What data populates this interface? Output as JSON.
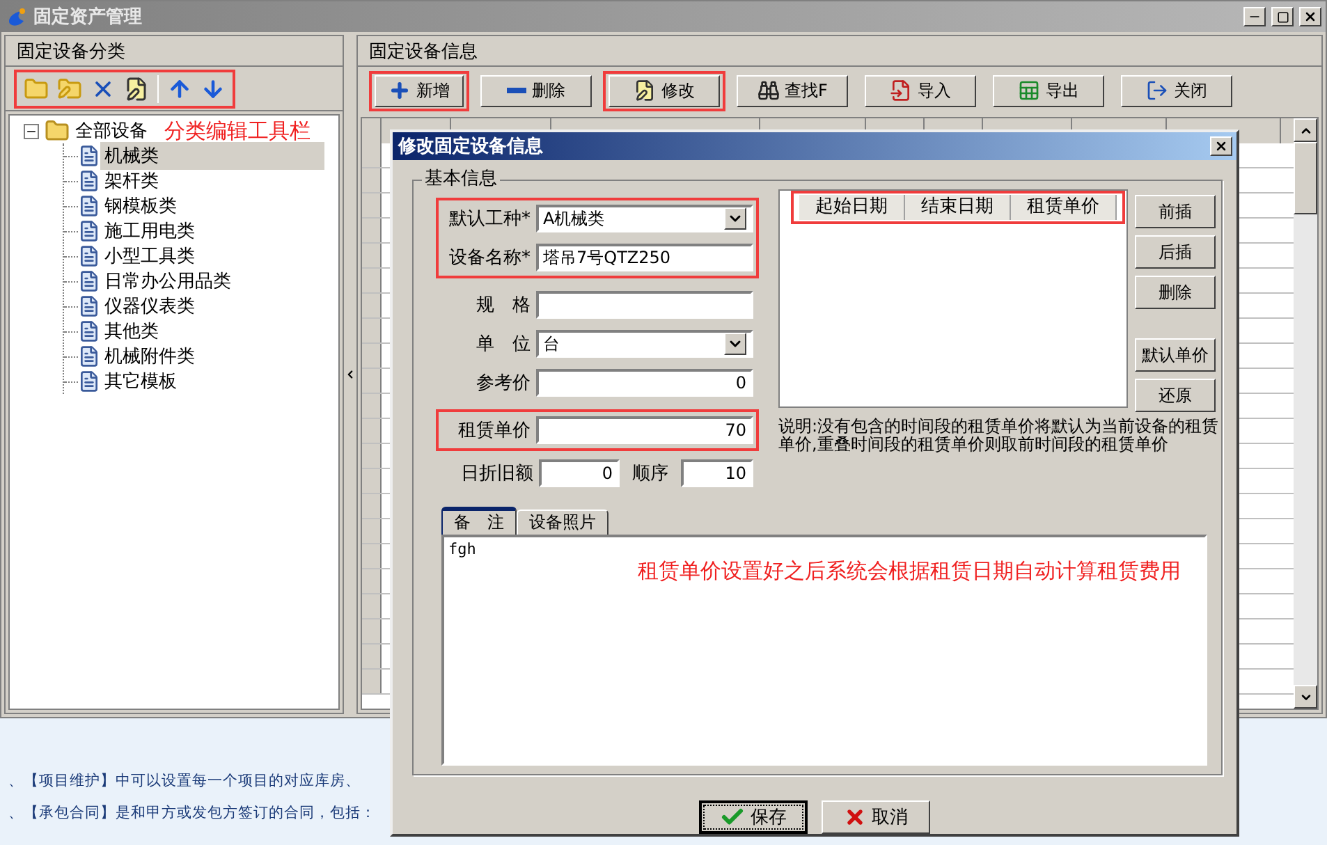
{
  "window": {
    "title": "固定资产管理"
  },
  "left_panel": {
    "title": "固定设备分类",
    "toolbar": {
      "highlighted": true,
      "tools": [
        {
          "kind": "new-folder"
        },
        {
          "kind": "edit-folder"
        },
        {
          "kind": "delete"
        },
        {
          "kind": "edit"
        },
        {
          "kind": "up"
        },
        {
          "kind": "down"
        }
      ]
    },
    "tree": {
      "label": "全部设备",
      "expanded": true,
      "annotation": "分类编辑工具栏",
      "children": [
        {
          "label": "机械类",
          "selected": true
        },
        {
          "label": "架杆类",
          "selected": false
        },
        {
          "label": "钢模板类",
          "selected": false
        },
        {
          "label": "施工用电类",
          "selected": false
        },
        {
          "label": "小型工具类",
          "selected": false
        },
        {
          "label": "日常办公用品类",
          "selected": false
        },
        {
          "label": "仪器仪表类",
          "selected": false
        },
        {
          "label": "其他类",
          "selected": false
        },
        {
          "label": "机械附件类",
          "selected": false
        },
        {
          "label": "其它模板",
          "selected": false
        }
      ]
    }
  },
  "right_panel": {
    "title": "固定设备信息",
    "toolbar": [
      {
        "label": "新增",
        "highlighted": true
      },
      {
        "label": "删除",
        "highlighted": false
      },
      {
        "label": "修改",
        "highlighted": true
      },
      {
        "label": "查找F",
        "highlighted": false
      },
      {
        "label": "导入",
        "highlighted": false
      },
      {
        "label": "导出",
        "highlighted": false
      },
      {
        "label": "关闭",
        "highlighted": false
      }
    ]
  },
  "dialog": {
    "title": "修改固定设备信息",
    "group_title": "基本信息",
    "field_groups": [
      {
        "highlighted": true,
        "fields": [
          {
            "label": "默认工种*",
            "kind": "select",
            "value": "A机械类"
          },
          {
            "label": "设备名称*",
            "kind": "text",
            "value": "塔吊7号QTZ250"
          }
        ]
      },
      {
        "highlighted": false,
        "fields": [
          {
            "label": "规　格",
            "kind": "text"
          },
          {
            "label": "单　位",
            "kind": "select",
            "value": "台"
          },
          {
            "label": "参考价",
            "kind": "number",
            "value": "0"
          }
        ]
      },
      {
        "highlighted": true,
        "fields": [
          {
            "label": "租赁单价",
            "kind": "number",
            "value": "70"
          }
        ]
      }
    ],
    "last_row": [
      {
        "label": "日折旧额",
        "value": "0"
      },
      {
        "label": "顺序",
        "value": "10"
      }
    ],
    "rental_table": {
      "highlighted": true,
      "columns": [
        "起始日期",
        "结束日期",
        "租赁单价"
      ]
    },
    "side_button_groups": [
      [
        "前插",
        "后插",
        "删除"
      ],
      [
        "默认单价",
        "还原"
      ]
    ],
    "note": "说明:没有包含的时间段的租赁单价将默认为当前设备的租赁单价,重叠时间段的租赁单价则取前时间段的租赁单价",
    "tabs": [
      {
        "label": "备　注",
        "selected": true
      },
      {
        "label": "设备照片",
        "selected": false
      }
    ],
    "memo": {
      "value": "fgh",
      "annotation": "租赁单价设置好之后系统会根据租赁日期自动计算租赁费用"
    },
    "buttons": [
      {
        "label": "保存",
        "default": true
      },
      {
        "label": "取消",
        "default": false
      }
    ]
  },
  "help_lines": [
    "、【项目维护】中可以设置每一个项目的对应库房、",
    "、【承包合同】是和甲方或发包方签订的合同，包括："
  ]
}
